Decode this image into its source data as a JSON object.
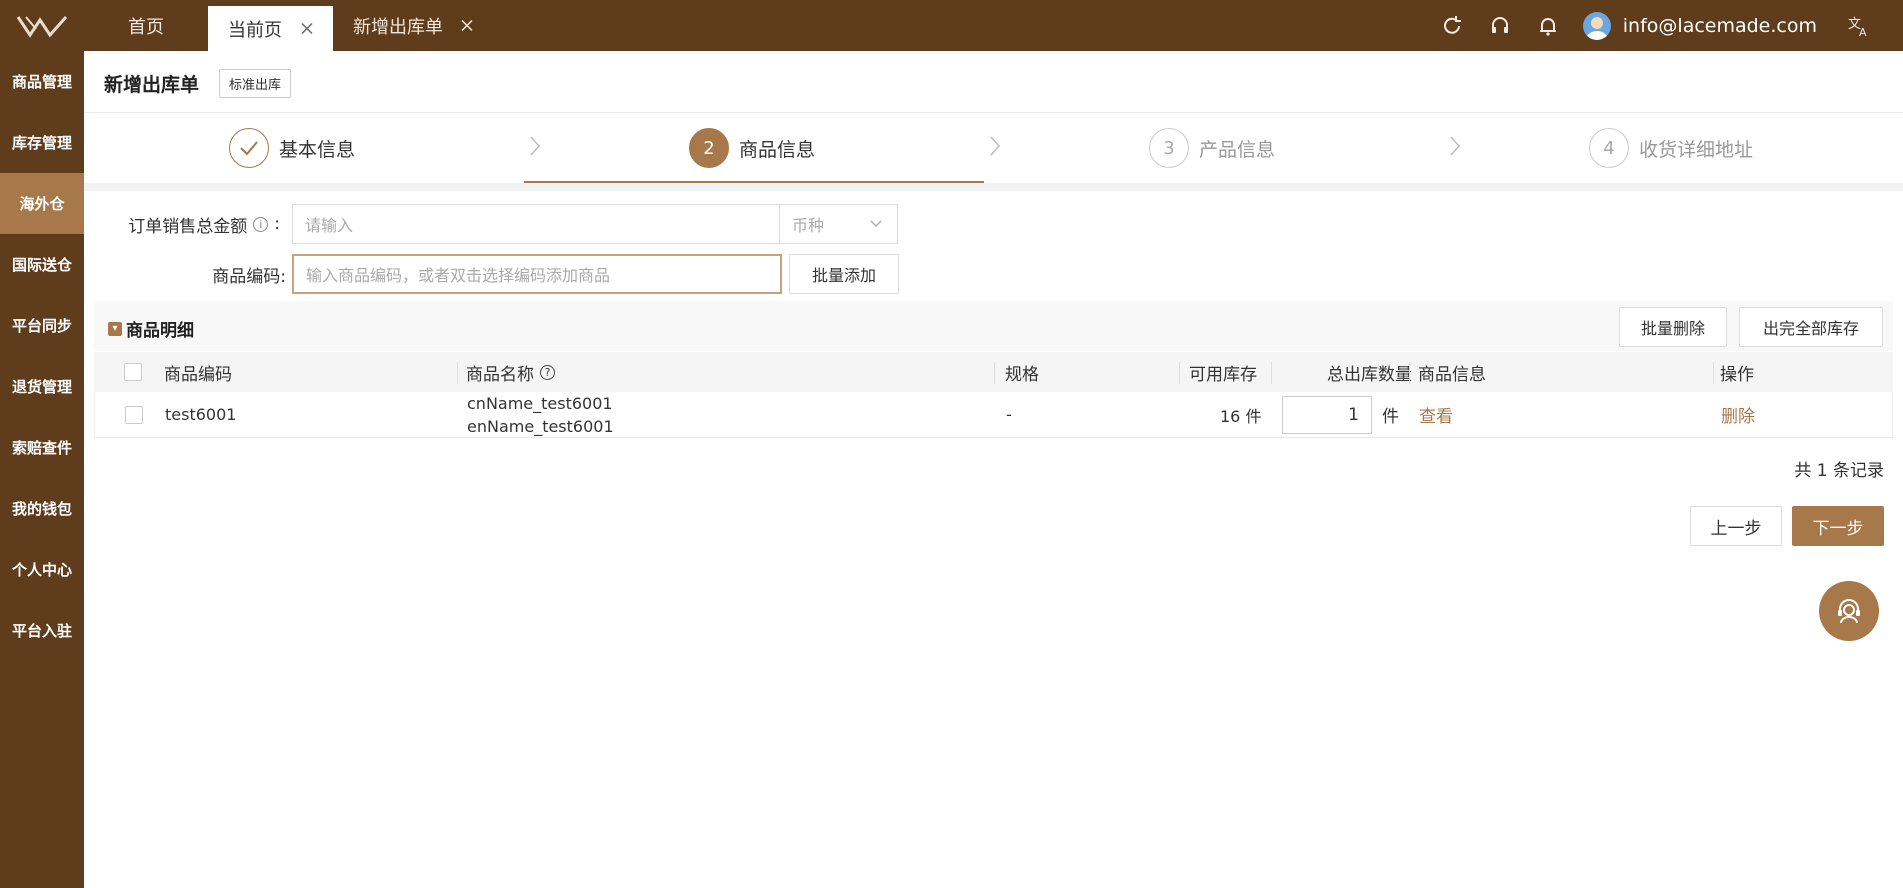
{
  "app": {
    "accent": "#a77849",
    "topbar_color": "#5e3c1c"
  },
  "tabs": [
    {
      "label": "首页"
    },
    {
      "label": "当前页",
      "close": "X"
    },
    {
      "label": "新增出库单",
      "close": "X"
    }
  ],
  "user": {
    "email": "info@lacemade.com"
  },
  "sidebar": {
    "items": [
      {
        "label": "商品管理"
      },
      {
        "label": "库存管理"
      },
      {
        "label": "海外仓"
      },
      {
        "label": "国际送仓"
      },
      {
        "label": "平台同步"
      },
      {
        "label": "退货管理"
      },
      {
        "label": "索赔查件"
      },
      {
        "label": "我的钱包"
      },
      {
        "label": "个人中心"
      },
      {
        "label": "平台入驻"
      }
    ]
  },
  "page": {
    "title": "新增出库单",
    "tag": "标准出库"
  },
  "steps": [
    {
      "num": "✓",
      "label": "基本信息"
    },
    {
      "num": "2",
      "label": "商品信息"
    },
    {
      "num": "3",
      "label": "产品信息"
    },
    {
      "num": "4",
      "label": "收货详细地址"
    }
  ],
  "form": {
    "amount_label": "订单销售总金额",
    "amount_colon": ":",
    "amount_placeholder": "请输入",
    "currency_placeholder": "币种",
    "code_label": "商品编码:",
    "code_placeholder": "输入商品编码，或者双击选择编码添加商品",
    "batch_add": "批量添加"
  },
  "section": {
    "title": "商品明细",
    "batch_delete": "批量删除",
    "out_all": "出完全部库存"
  },
  "table": {
    "headers": {
      "code": "商品编码",
      "name": "商品名称",
      "spec": "规格",
      "stock": "可用库存",
      "qty": "总出库数量",
      "info": "商品信息",
      "op": "操作"
    },
    "rows": [
      {
        "code": "test6001",
        "name_cn": "cnName_test6001",
        "name_en": "enName_test6001",
        "spec": "-",
        "stock": "16 件",
        "qty": "1",
        "unit": "件",
        "view": "查看",
        "delete": "删除"
      }
    ]
  },
  "pagination": {
    "total": "共 1 条记录"
  },
  "nav": {
    "prev": "上一步",
    "next": "下一步"
  }
}
